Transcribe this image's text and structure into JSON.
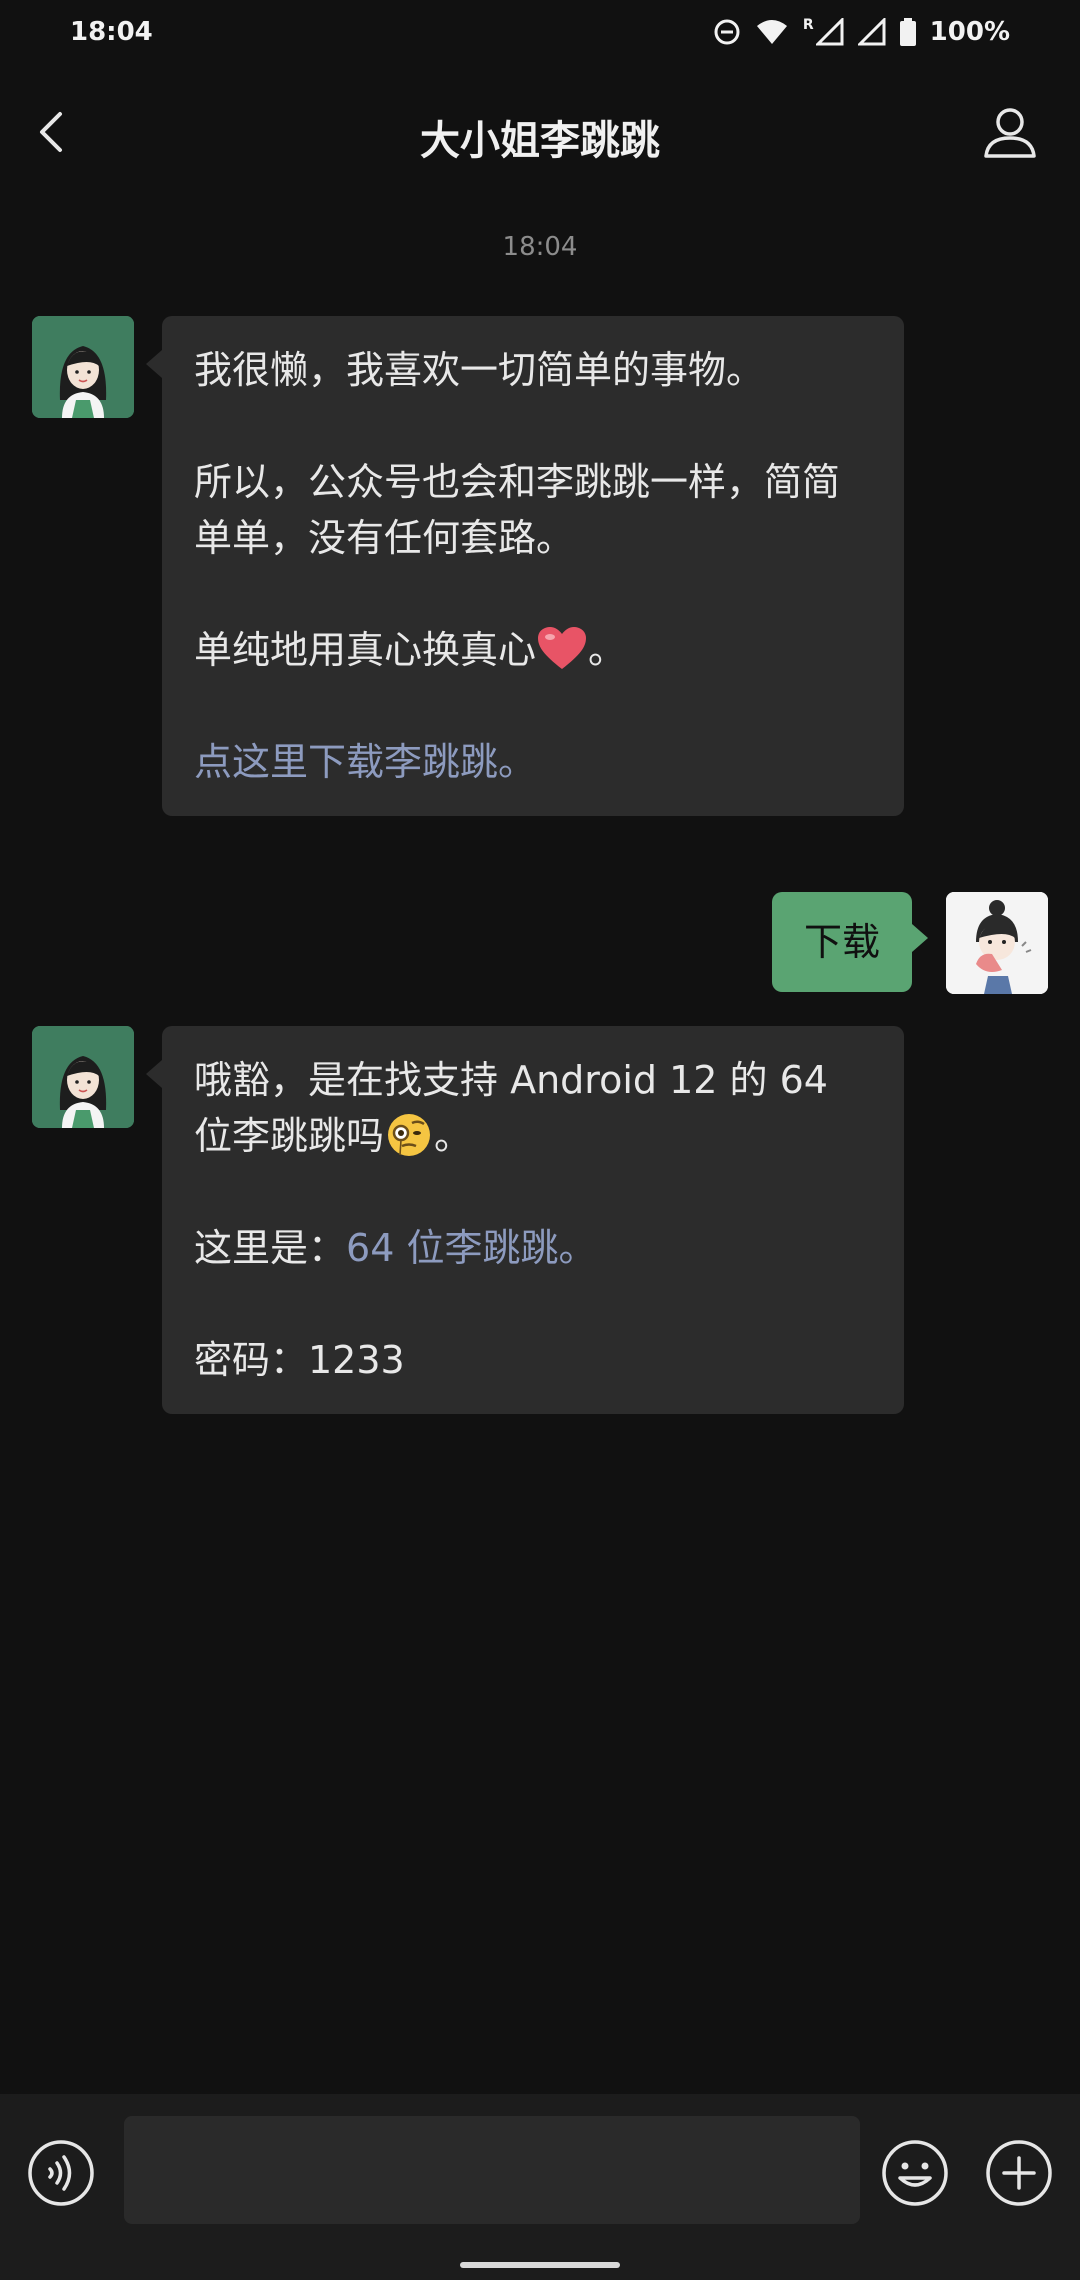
{
  "status_bar": {
    "time": "18:04",
    "battery": "100%",
    "network_badge": "R"
  },
  "header": {
    "title": "大小姐李跳跳",
    "back_icon": "chevron-left-icon",
    "profile_icon": "person-icon"
  },
  "chat": {
    "timestamp": "18:04",
    "messages": [
      {
        "sender": "bot",
        "paragraphs": [
          "我很懒，我喜欢一切简单的事物。",
          "所以，公众号也会和李跳跳一样，简简单单，没有任何套路。"
        ],
        "line3_text": "单纯地用真心换真心",
        "line3_tail": "。",
        "link": "点这里下载李跳跳。"
      },
      {
        "sender": "me",
        "text": "下载"
      },
      {
        "sender": "bot",
        "line1_text": "哦豁，是在找支持 Android 12 的 64 位李跳跳吗",
        "line1_tail": "。",
        "line2_prefix": "这里是：",
        "line2_link": "64 位李跳跳。",
        "line3": "密码：1233"
      }
    ]
  },
  "input_bar": {
    "voice_icon": "voice-icon",
    "emoji_icon": "emoji-icon",
    "plus_icon": "plus-icon",
    "input_value": ""
  },
  "colors": {
    "background": "#111111",
    "bubble_incoming": "#2c2c2c",
    "bubble_outgoing": "#5aa472",
    "link": "#8d9bbf",
    "avatar_bot_bg": "#3f7d5f"
  }
}
